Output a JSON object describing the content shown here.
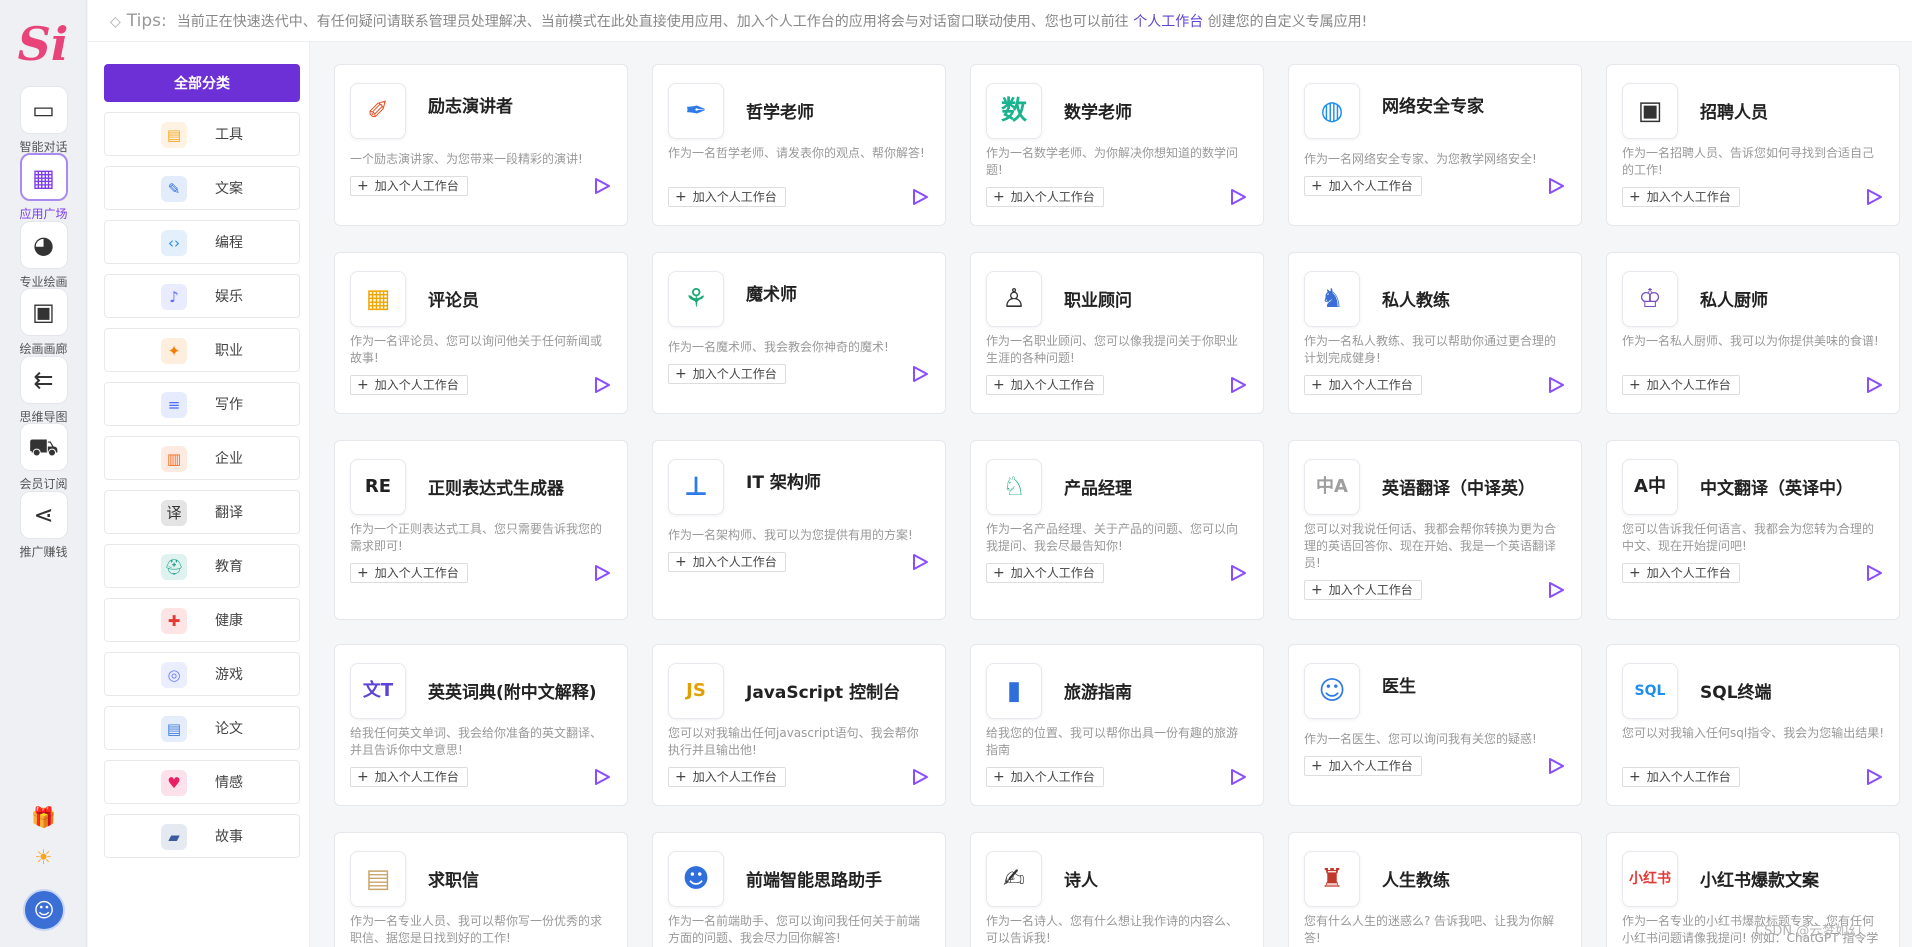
{
  "app": {
    "logo_text": "Si"
  },
  "rail": {
    "items": [
      {
        "label": "智能对话",
        "icon": "chat-icon",
        "glyph": "▭"
      },
      {
        "label": "应用广场",
        "icon": "grid-icon",
        "glyph": "▦"
      },
      {
        "label": "专业绘画",
        "icon": "palette-icon",
        "glyph": "◕"
      },
      {
        "label": "绘画画廊",
        "icon": "gallery-icon",
        "glyph": "▣"
      },
      {
        "label": "思维导图",
        "icon": "mindmap-icon",
        "glyph": "⇇"
      },
      {
        "label": "会员订阅",
        "icon": "cart-icon",
        "glyph": "⛟"
      },
      {
        "label": "推广赚钱",
        "icon": "share-icon",
        "glyph": "⋖"
      }
    ],
    "gift_glyph": "🎁",
    "sun_glyph": "☀",
    "avatar_glyph": "☺"
  },
  "tips": {
    "label": "Tips:",
    "text": "当前正在快速迭代中、有任何疑问请联系管理员处理解决、当前模式在此处直接使用应用、加入个人工作台的应用将会与对话窗口联动使用、您也可以前往",
    "link": "个人工作台",
    "tail": "创建您的自定义专属应用!"
  },
  "categories": {
    "all_label": "全部分类",
    "items": [
      {
        "label": "工具",
        "icon": "toolbox-icon",
        "glyph": "▤",
        "color": "#f5a623"
      },
      {
        "label": "文案",
        "icon": "document-icon",
        "glyph": "✎",
        "color": "#2f6fdb"
      },
      {
        "label": "编程",
        "icon": "code-icon",
        "glyph": "‹›",
        "color": "#2b8be6"
      },
      {
        "label": "娱乐",
        "icon": "entertainment-icon",
        "glyph": "♪",
        "color": "#5b6cff"
      },
      {
        "label": "职业",
        "icon": "career-icon",
        "glyph": "✦",
        "color": "#f57c00"
      },
      {
        "label": "写作",
        "icon": "writing-icon",
        "glyph": "≡",
        "color": "#4a6cf7"
      },
      {
        "label": "企业",
        "icon": "enterprise-icon",
        "glyph": "▥",
        "color": "#f26b21"
      },
      {
        "label": "翻译",
        "icon": "translate-icon",
        "glyph": "译",
        "color": "#333333"
      },
      {
        "label": "教育",
        "icon": "education-icon",
        "glyph": "⛑",
        "color": "#1aa08a"
      },
      {
        "label": "健康",
        "icon": "health-icon",
        "glyph": "✚",
        "color": "#e53935"
      },
      {
        "label": "游戏",
        "icon": "game-icon",
        "glyph": "◎",
        "color": "#6b7cff"
      },
      {
        "label": "论文",
        "icon": "paper-icon",
        "glyph": "▤",
        "color": "#3d7be0"
      },
      {
        "label": "情感",
        "icon": "emotion-icon",
        "glyph": "♥",
        "color": "#e91e63"
      },
      {
        "label": "故事",
        "icon": "story-icon",
        "glyph": "▰",
        "color": "#3d5a9e"
      }
    ]
  },
  "cards": {
    "add_label": "加入个人工作台",
    "items": [
      {
        "title": "励志演讲者",
        "desc": "一个励志演讲家、为您带来一段精彩的演讲!",
        "icon": "speaker-icon",
        "glyph": "✐",
        "color": "#e8572a"
      },
      {
        "title": "哲学老师",
        "desc": "作为一名哲学老师、请发表你的观点、帮你解答!",
        "icon": "feather-icon",
        "glyph": "✒",
        "color": "#2f7be6"
      },
      {
        "title": "数学老师",
        "desc": "作为一名数学老师、为你解决你想知道的数学问题!",
        "icon": "math-book-icon",
        "glyph": "数",
        "color": "#19b38f"
      },
      {
        "title": "网络安全专家",
        "desc": "作为一名网络安全专家、为您教学网络安全!",
        "icon": "shield-globe-icon",
        "glyph": "◍",
        "color": "#1f8ef1"
      },
      {
        "title": "招聘人员",
        "desc": "作为一名招聘人员、告诉您如何寻找到合适自己的工作!",
        "icon": "recruiter-icon",
        "glyph": "▣",
        "color": "#333333"
      },
      {
        "title": "评论员",
        "desc": "作为一名评论员、您可以询问他关于任何新闻或故事!",
        "icon": "comment-icon",
        "glyph": "▦",
        "color": "#f0a500"
      },
      {
        "title": "魔术师",
        "desc": "作为一名魔术师、我会教会你神奇的魔术!",
        "icon": "magic-hat-icon",
        "glyph": "⚘",
        "color": "#19a974"
      },
      {
        "title": "职业顾问",
        "desc": "作为一名职业顾问、您可以像我提问关于你职业生涯的各种问题!",
        "icon": "advisor-icon",
        "glyph": "♙",
        "color": "#333333"
      },
      {
        "title": "私人教练",
        "desc": "作为一名私人教练、我可以帮助你通过更合理的计划完成健身!",
        "icon": "trainer-icon",
        "glyph": "♞",
        "color": "#3b6fd6"
      },
      {
        "title": "私人厨师",
        "desc": "作为一名私人厨师、我可以为你提供美味的食谱!",
        "icon": "chef-icon",
        "glyph": "♔",
        "color": "#7a4fc2"
      },
      {
        "title": "正则表达式生成器",
        "desc": "作为一个正则表达式工具、您只需要告诉我您的需求即可!",
        "icon": "regex-icon",
        "glyph": "RE",
        "color": "#222222"
      },
      {
        "title": "IT 架构师",
        "desc": "作为一名架构师、我可以为您提供有用的方案!",
        "icon": "architecture-icon",
        "glyph": "⊥",
        "color": "#2f7be6"
      },
      {
        "title": "产品经理",
        "desc": "作为一名产品经理、关于产品的问题、您可以向我提问、我会尽最告知你!",
        "icon": "product-manager-icon",
        "glyph": "♘",
        "color": "#19a974"
      },
      {
        "title": "英语翻译（中译英）",
        "desc": "您可以对我说任何话、我都会帮你转换为更为合理的英语回答你、现在开始、我是一个英语翻译员!",
        "icon": "translate-cn-en-icon",
        "glyph": "中A",
        "color": "#9e9e9e"
      },
      {
        "title": "中文翻译（英译中）",
        "desc": "您可以告诉我任何语言、我都会为您转为合理的中文、现在开始提问吧!",
        "icon": "translate-en-cn-icon",
        "glyph": "A中",
        "color": "#222222"
      },
      {
        "title": "英英词典(附中文解释)",
        "desc": "给我任何英文单词、我会给你准备的英文翻译、并且告诉你中文意思!",
        "icon": "dictionary-icon",
        "glyph": "文T",
        "color": "#5b45d6"
      },
      {
        "title": "JavaScript 控制台",
        "desc": "您可以对我输出任何javascript语句、我会帮你执行并且输出他!",
        "icon": "javascript-icon",
        "glyph": "JS",
        "color": "#e0a100"
      },
      {
        "title": "旅游指南",
        "desc": "给我您的位置、我可以帮你出具一份有趣的旅游指南",
        "icon": "travel-guide-icon",
        "glyph": "▮",
        "color": "#2f6fdb"
      },
      {
        "title": "医生",
        "desc": "作为一名医生、您可以询问我有关您的疑惑!",
        "icon": "doctor-icon",
        "glyph": "☺",
        "color": "#2f7be6"
      },
      {
        "title": "SQL终端",
        "desc": "您可以对我输入任何sql指令、我会为您输出结果!",
        "icon": "sql-icon",
        "glyph": "SQL",
        "color": "#1f8ef1"
      },
      {
        "title": "求职信",
        "desc": "作为一名专业人员、我可以帮你写一份优秀的求职信、据您是日找到好的工作!",
        "icon": "cover-letter-icon",
        "glyph": "▤",
        "color": "#c9a66b"
      },
      {
        "title": "前端智能思路助手",
        "desc": "作为一名前端助手、您可以询问我任何关于前端方面的问题、我会尽力回你解答!",
        "icon": "robot-icon",
        "glyph": "☻",
        "color": "#2f6fdb"
      },
      {
        "title": "诗人",
        "desc": "作为一名诗人、您有什么想让我作诗的内容么、可以告诉我!",
        "icon": "poet-icon",
        "glyph": "✍",
        "color": "#333333"
      },
      {
        "title": "人生教练",
        "desc": "您有什么人生的迷惑么? 告诉我吧、让我为你解答!",
        "icon": "lighthouse-icon",
        "glyph": "♜",
        "color": "#c0392b"
      },
      {
        "title": "小红书爆款文案",
        "desc": "作为一名专业的小红书爆款标题专家、您有任何小红书问题请像我提问! 例如：ChatGPT 指令学",
        "icon": "xiaohongshu-icon",
        "glyph": "小红书",
        "color": "#e53935"
      }
    ]
  },
  "watermark": "CSDN @云梦如幻"
}
